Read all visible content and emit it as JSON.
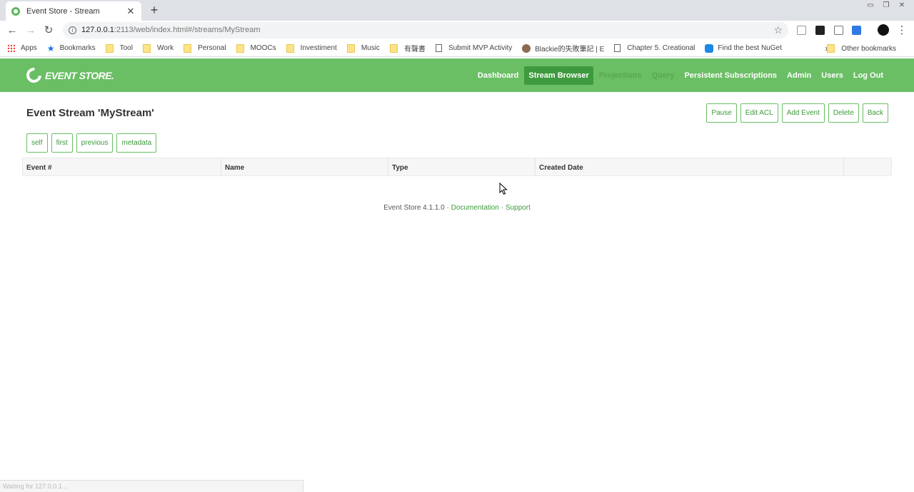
{
  "browser": {
    "tab_title": "Event Store - Stream",
    "url_host": "127.0.0.1",
    "url_rest": ":2113/web/index.html#/streams/MyStream",
    "bookmarks": [
      {
        "label": "Apps",
        "icon": "apps-icon"
      },
      {
        "label": "Bookmarks",
        "icon": "star-icon"
      },
      {
        "label": "Tool",
        "icon": "folder-icon"
      },
      {
        "label": "Work",
        "icon": "folder-icon"
      },
      {
        "label": "Personal",
        "icon": "folder-icon"
      },
      {
        "label": "MOOCs",
        "icon": "folder-icon"
      },
      {
        "label": "Investiment",
        "icon": "folder-icon"
      },
      {
        "label": "Music",
        "icon": "folder-icon"
      },
      {
        "label": "有聲書",
        "icon": "folder-icon"
      },
      {
        "label": "Submit MVP Activity",
        "icon": "page-icon"
      },
      {
        "label": "Blackie的失敗筆記 | E",
        "icon": "avatar-icon"
      },
      {
        "label": "Chapter 5. Creational",
        "icon": "page-icon"
      },
      {
        "label": "Find the best NuGet",
        "icon": "nuget-icon"
      }
    ],
    "bookmarks_more": "»",
    "other_bookmarks": "Other bookmarks",
    "status_text": "Waiting for 127.0.0.1..."
  },
  "app": {
    "logo_text": "EVENT STORE.",
    "nav": {
      "dashboard": "Dashboard",
      "stream_browser": "Stream Browser",
      "projections": "Projections",
      "query": "Query",
      "persistent_subscriptions": "Persistent Subscriptions",
      "admin": "Admin",
      "users": "Users",
      "log_out": "Log Out"
    },
    "page_title": "Event Stream 'MyStream'",
    "actions": {
      "pause": "Pause",
      "edit_acl": "Edit ACL",
      "add_event": "Add Event",
      "delete": "Delete",
      "back": "Back"
    },
    "pager": {
      "self": "self",
      "first": "first",
      "previous": "previous",
      "metadata": "metadata"
    },
    "table": {
      "columns": [
        "Event #",
        "Name",
        "Type",
        "Created Date",
        ""
      ]
    },
    "footer": {
      "version": "Event Store 4.1.1.0",
      "sep1": "·",
      "documentation": "Documentation",
      "sep2": "·",
      "support": "Support"
    }
  },
  "colors": {
    "nav_green": "#6abe64",
    "active_green": "#3e9a3e",
    "link_green": "#3c9a3c"
  }
}
